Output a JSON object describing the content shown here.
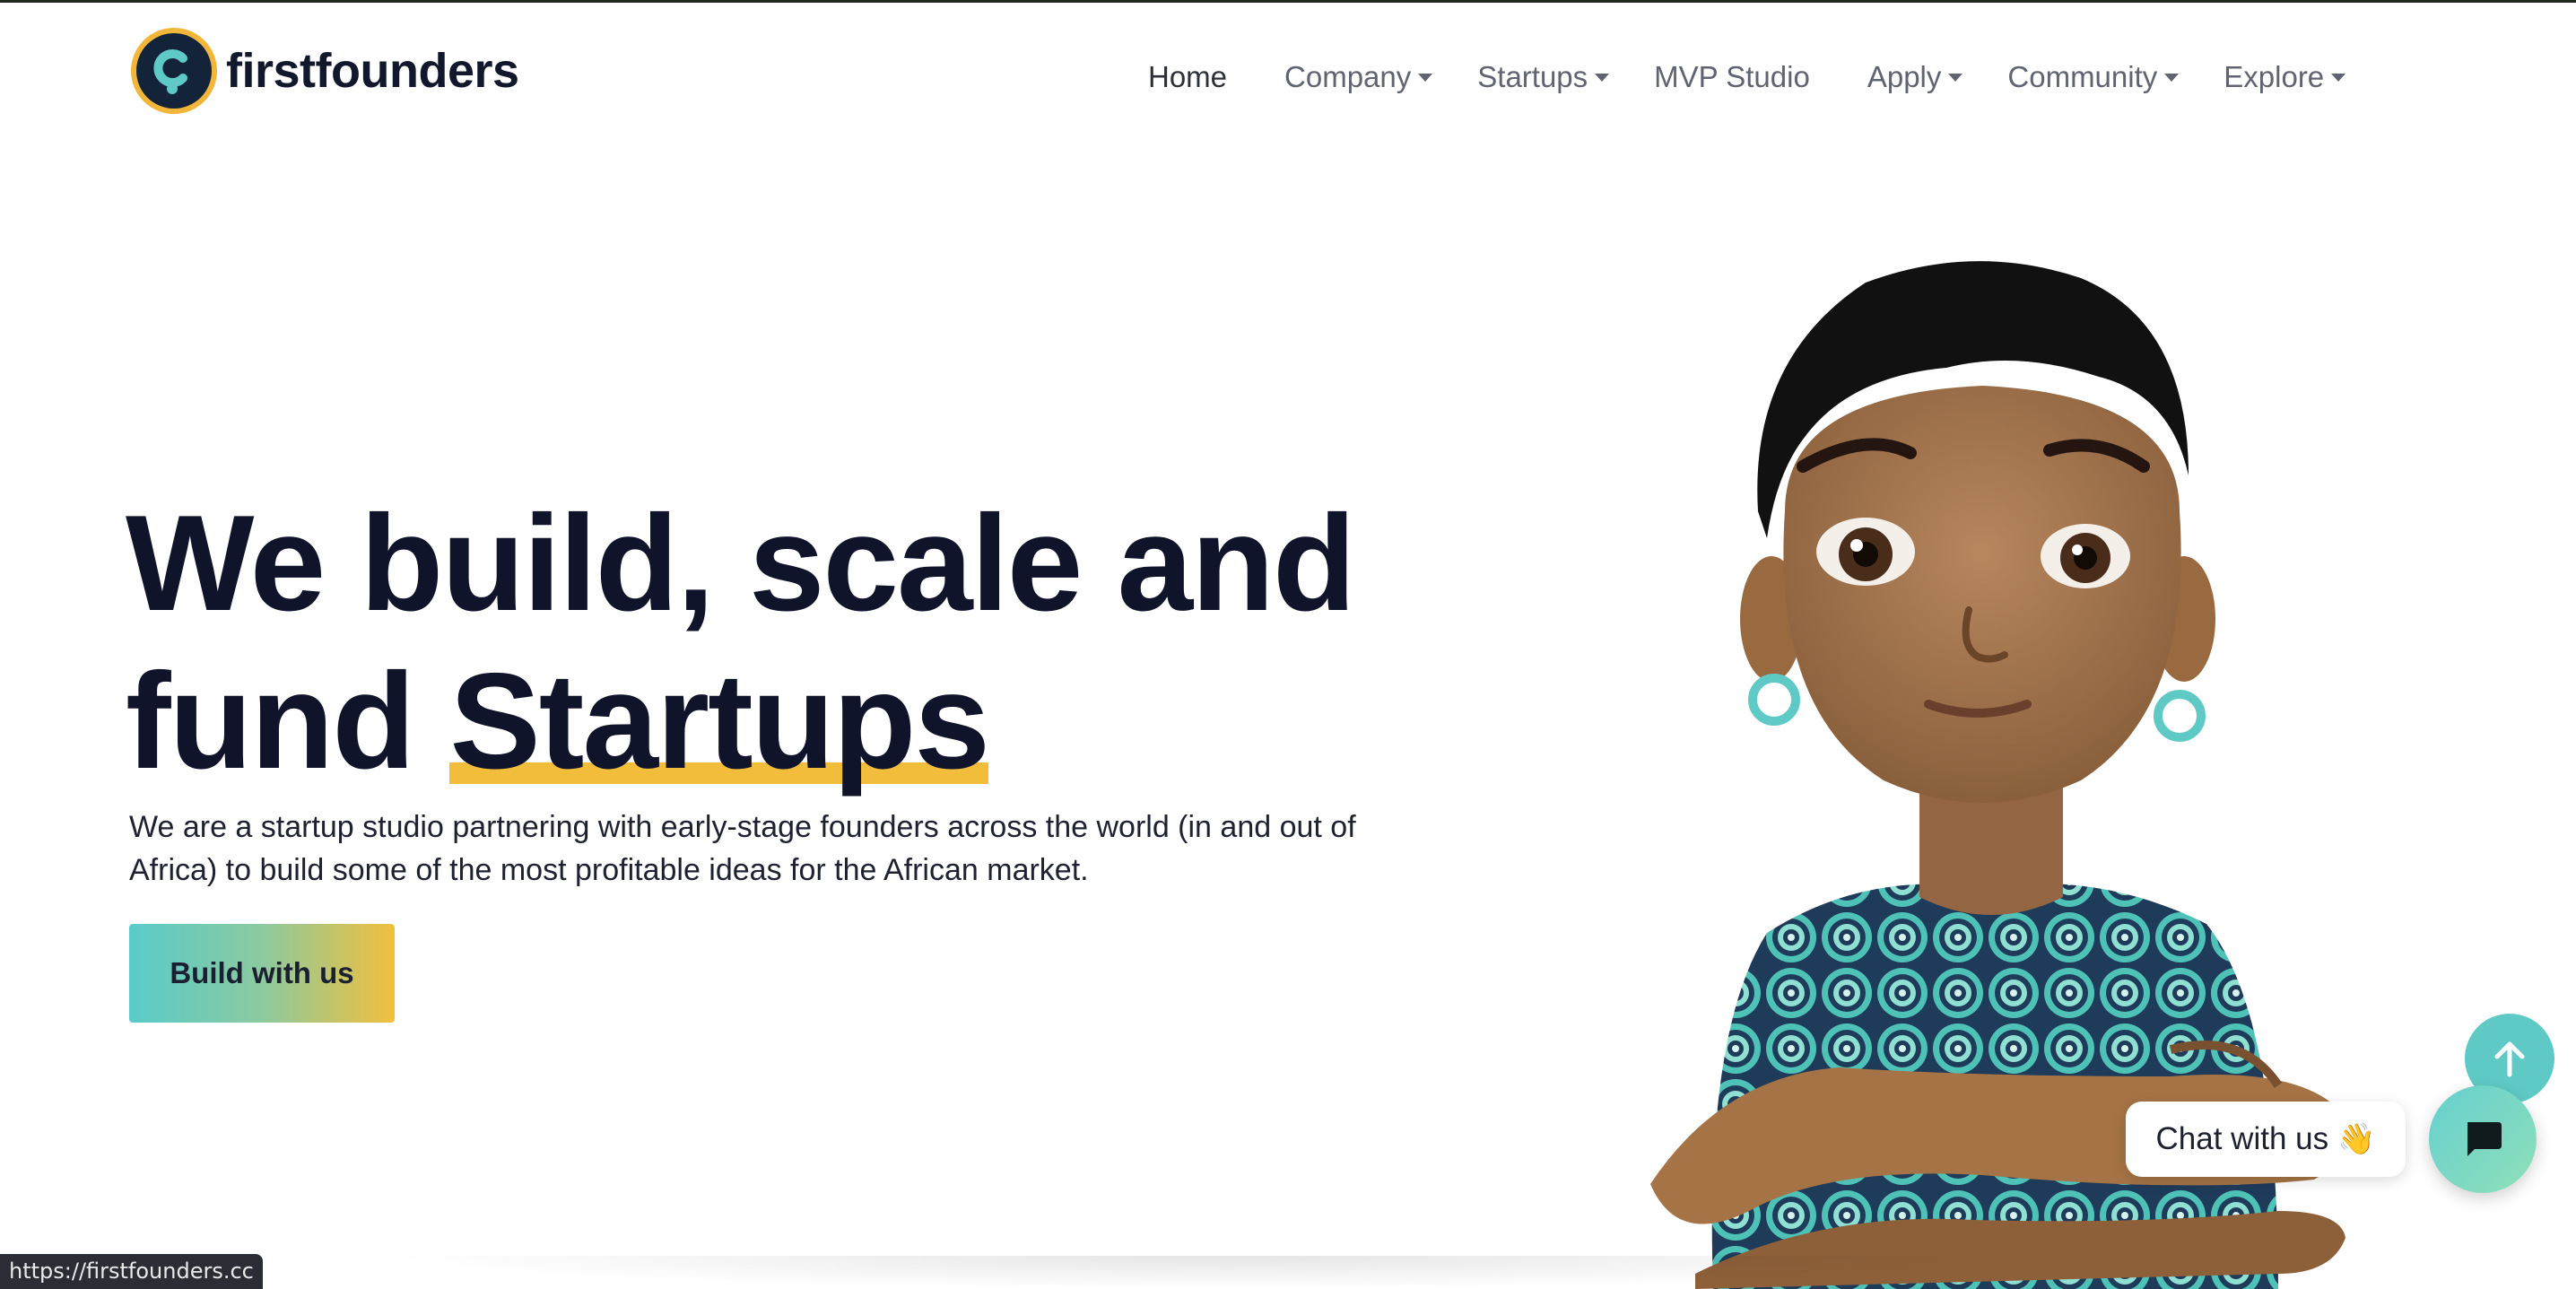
{
  "brand": {
    "name": "firstfounders",
    "logo_icon": "first-founders-logo",
    "colors": {
      "navy": "#10142b",
      "yellow": "#f2bd3a",
      "teal": "#5fcac5"
    }
  },
  "nav": {
    "items": [
      {
        "label": "Home",
        "has_dropdown": false,
        "active": true
      },
      {
        "label": "Company",
        "has_dropdown": true
      },
      {
        "label": "Startups",
        "has_dropdown": true
      },
      {
        "label": "MVP Studio",
        "has_dropdown": false
      },
      {
        "label": "Apply",
        "has_dropdown": true
      },
      {
        "label": "Community",
        "has_dropdown": true
      },
      {
        "label": "Explore",
        "has_dropdown": true
      }
    ]
  },
  "hero": {
    "title_line1": "We build, scale and",
    "title_line2_prefix": "fund",
    "title_highlight": "Startups",
    "subtitle": "We are a startup studio partnering with early-stage founders across the world (in and out of Africa) to build some of the most profitable ideas for the African market.",
    "cta_label": "Build with us"
  },
  "illustration": {
    "subject": "3d-character-woman-arms-crossed"
  },
  "widgets": {
    "chat_label": "Chat with us",
    "chat_emoji": "👋",
    "scroll_top_icon": "arrow-up-icon",
    "chat_icon": "chat-icon"
  },
  "status_bar": {
    "url": "https://firstfounders.cc"
  }
}
